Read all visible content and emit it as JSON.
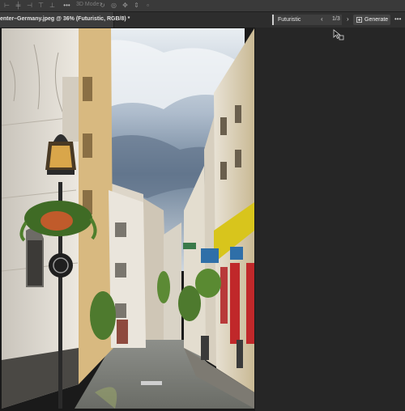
{
  "options_bar": {
    "label": "3D Mode:"
  },
  "document_tab": {
    "title": "enter–Germany.jpeg @ 36% (Futuristic, RGB/8) *"
  },
  "contextual_taskbar": {
    "prompt_value": "Futuristic",
    "variation_counter": "1/3",
    "prev_icon": "chevron-left-icon",
    "next_icon": "chevron-right-icon",
    "generate_label": "Generate",
    "more_icon": "ellipsis-icon"
  },
  "canvas": {
    "image_description_icon": "photo-canvas"
  }
}
